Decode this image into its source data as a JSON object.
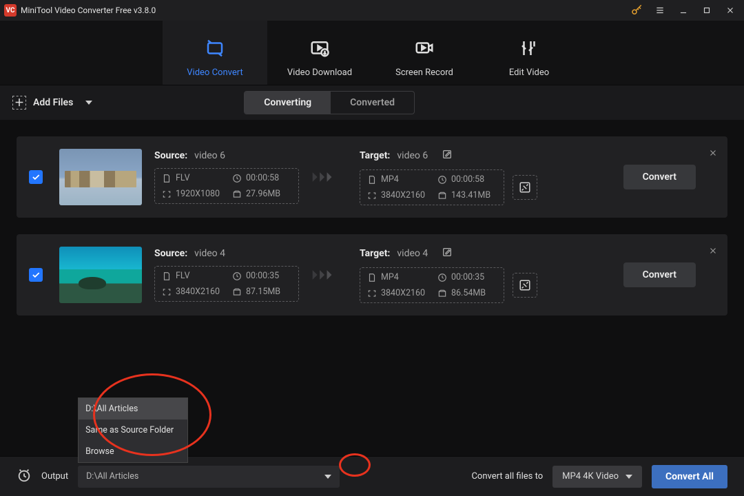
{
  "app": {
    "title": "MiniTool Video Converter Free v3.8.0"
  },
  "nav": {
    "convert": "Video Convert",
    "download": "Video Download",
    "record": "Screen Record",
    "edit": "Edit Video"
  },
  "subbar": {
    "add_files": "Add Files",
    "convert_tabs": {
      "converting": "Converting",
      "converted": "Converted"
    }
  },
  "labels": {
    "source": "Source:",
    "target": "Target:"
  },
  "items": [
    {
      "source_name": "video 6",
      "target_name": "video 6",
      "source": {
        "format": "FLV",
        "duration": "00:00:58",
        "resolution": "1920X1080",
        "size": "27.96MB"
      },
      "target": {
        "format": "MP4",
        "duration": "00:00:58",
        "resolution": "3840X2160",
        "size": "143.41MB"
      },
      "convert_label": "Convert"
    },
    {
      "source_name": "video 4",
      "target_name": "video 4",
      "source": {
        "format": "FLV",
        "duration": "00:00:35",
        "resolution": "3840X2160",
        "size": "87.15MB"
      },
      "target": {
        "format": "MP4",
        "duration": "00:00:35",
        "resolution": "3840X2160",
        "size": "86.54MB"
      },
      "convert_label": "Convert"
    }
  ],
  "footer": {
    "output_label": "Output",
    "output_value": "D:\\All Articles",
    "dropdown": {
      "opt1": "D:\\All Articles",
      "opt2": "Same as Source Folder",
      "opt3": "Browse"
    },
    "all_files_label": "Convert all files to",
    "preset": "MP4 4K Video",
    "convert_all": "Convert All"
  }
}
